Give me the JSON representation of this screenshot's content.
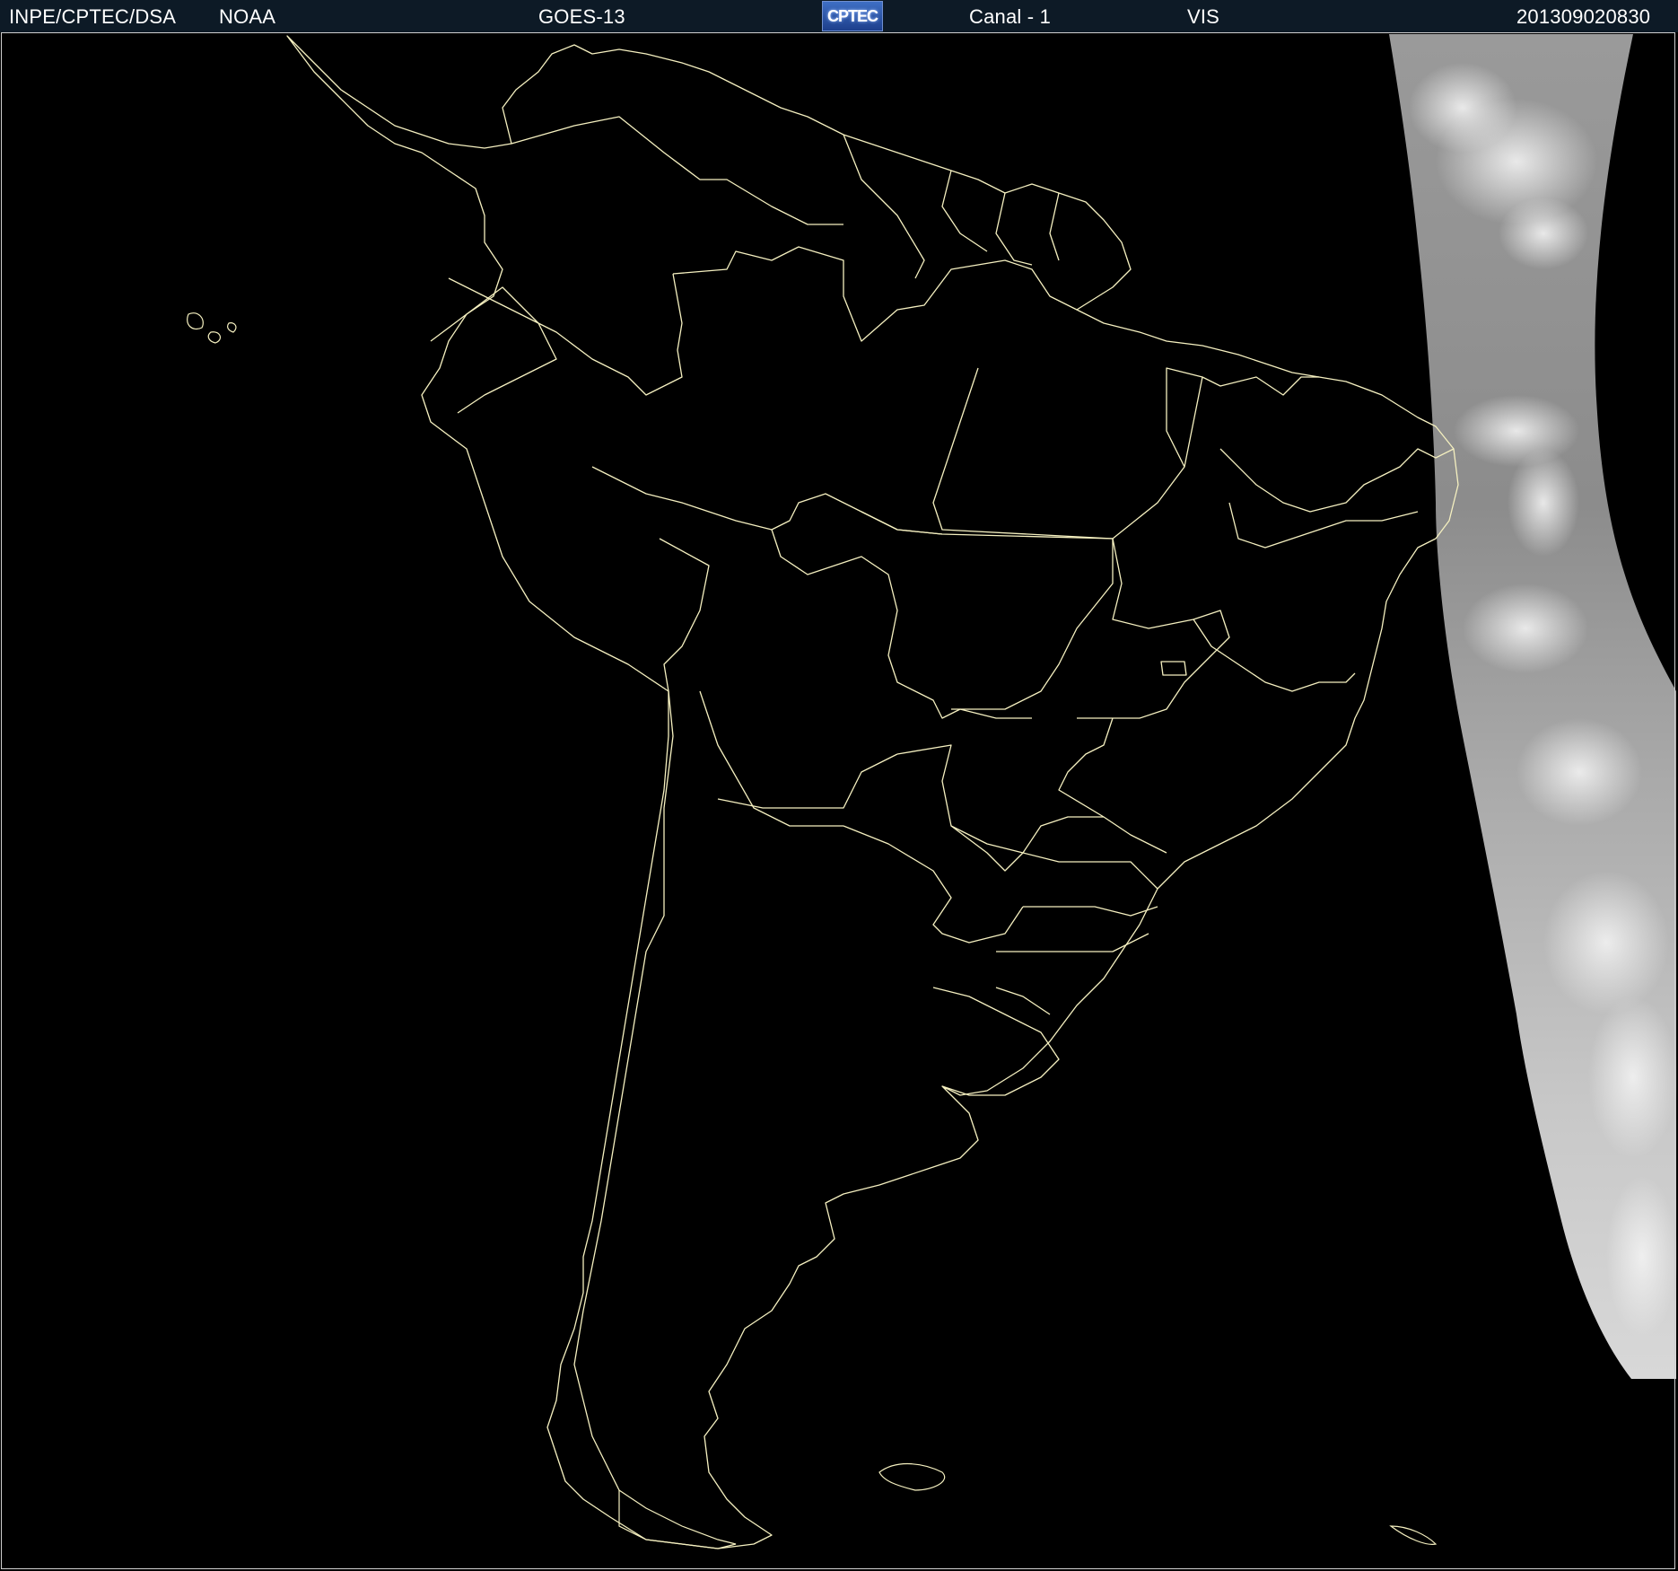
{
  "header": {
    "institution": "INPE/CPTEC/DSA",
    "agency": "NOAA",
    "satellite": "GOES-13",
    "logo_text": "CPTEC",
    "channel": "Canal - 1",
    "band": "VIS",
    "timestamp": "201309020830"
  },
  "map": {
    "region": "South America",
    "background_color": "#000000",
    "border_color": "#f5f0c0",
    "cloud_color": "#bdbdbd"
  }
}
